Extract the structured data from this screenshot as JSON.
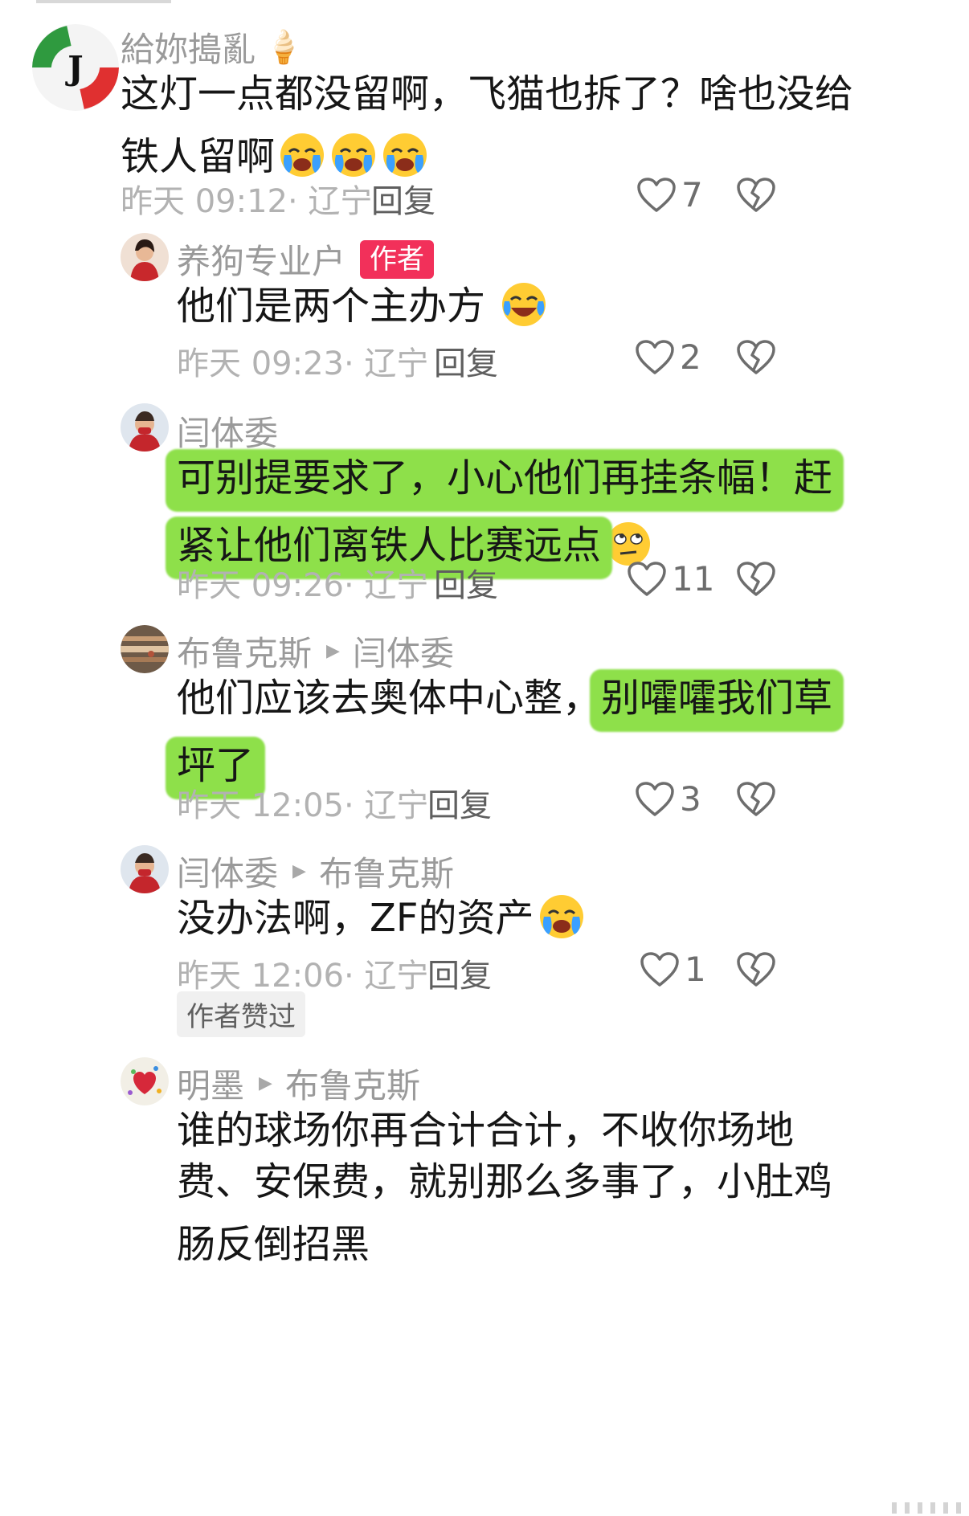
{
  "comments": [
    {
      "username": "給妳搗亂",
      "lines": [
        "这灯一点都没留啊，飞猫也拆了？啥也没给",
        "铁人留啊"
      ],
      "meta": "昨天 09:12· 辽宁",
      "reply_label": "回复",
      "likes": "7",
      "avatar_icon": "juventus-avatar-icon",
      "name_emoji": "ice-cream-icon",
      "text_emoji": "crying-face-icon"
    },
    {
      "username": "养狗专业户",
      "author_tag": "作者",
      "lines": [
        "他们是两个主办方"
      ],
      "meta": "昨天 09:23· 辽宁",
      "reply_label": "回复",
      "likes": "2",
      "text_emoji": "tears-of-joy-icon"
    },
    {
      "username": "闫体委",
      "lines": [
        "可别提要求了，小心他们再挂条幅！赶",
        "紧让他们离铁人比赛远点"
      ],
      "meta": "昨天 09:26· 辽宁",
      "reply_label": "回复",
      "likes": "11",
      "text_emoji": "rolling-eyes-icon"
    },
    {
      "username": "布鲁克斯",
      "reply_to": "闫体委",
      "lines_a": "他们应该去奥体中心整，",
      "lines_b": "别嚯嚯我们草",
      "line2": "坪了",
      "meta": "昨天 12:05· 辽宁",
      "reply_label": "回复",
      "likes": "3"
    },
    {
      "username": "闫体委",
      "reply_to": "布鲁克斯",
      "lines": [
        "没办法啊，ZF的资产"
      ],
      "meta": "昨天 12:06· 辽宁",
      "reply_label": "回复",
      "likes": "1",
      "liked_by_author": "作者赞过",
      "text_emoji": "crying-face-icon"
    },
    {
      "username": "明墨",
      "reply_to": "布鲁克斯",
      "lines": [
        "谁的球场你再合计合计，不收你场地",
        "费、安保费，就别那么多事了，小肚鸡",
        "肠反倒招黑"
      ]
    }
  ],
  "colors": {
    "highlight": "#8ee04a",
    "author_tag": "#f2305a",
    "username": "#9a9a9a",
    "meta": "#b2b2b2"
  }
}
